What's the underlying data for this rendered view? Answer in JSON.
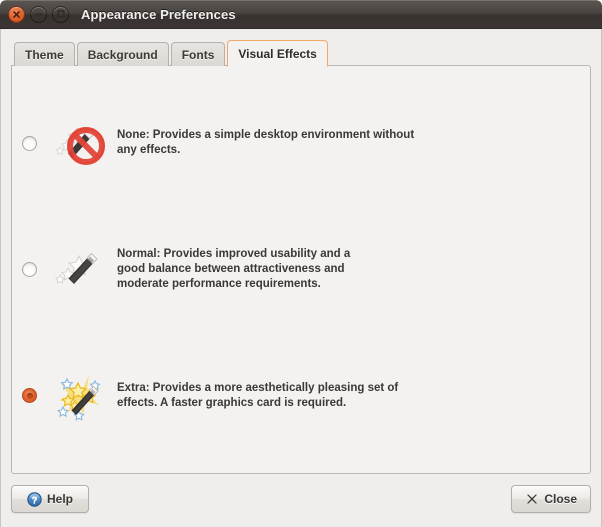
{
  "window": {
    "title": "Appearance Preferences",
    "controls": [
      {
        "name": "close",
        "icon": "close-icon",
        "color": "#e2612c"
      },
      {
        "name": "minimize",
        "icon": "minimize-icon",
        "color": "#726d69"
      },
      {
        "name": "maximize",
        "icon": "maximize-icon",
        "color": "#726d69"
      }
    ]
  },
  "tabs": [
    {
      "label": "Theme",
      "active": false
    },
    {
      "label": "Background",
      "active": false
    },
    {
      "label": "Fonts",
      "active": false
    },
    {
      "label": "Visual Effects",
      "active": true
    }
  ],
  "visual_effects": {
    "selected": "extra",
    "options": [
      {
        "id": "none",
        "icon": "magic-wand-disabled-icon",
        "selected": false,
        "bold_label": "None:",
        "text": "None: Provides a simple desktop environment without any effects."
      },
      {
        "id": "normal",
        "icon": "magic-wand-grayscale-icon",
        "selected": false,
        "bold_label": "Normal:",
        "text": "Normal: Provides improved usability and a good balance between attractiveness and moderate performance requirements."
      },
      {
        "id": "extra",
        "icon": "magic-wand-color-icon",
        "selected": true,
        "bold_label": "Extra:",
        "text": "Extra: Provides a more aesthetically pleasing set of effects. A faster graphics card is required."
      }
    ]
  },
  "actions": {
    "help_label": "Help",
    "help_icon": "help-circle-icon",
    "close_label": "Close",
    "close_icon": "close-x-icon"
  },
  "colors": {
    "accent": "#e2612c",
    "tab_active_border": "#f0a868",
    "titlebar_dark": "#3b3633",
    "panel_bg": "#f4f2f0",
    "dialog_bg": "#f0eeec",
    "text": "#3a3935"
  }
}
